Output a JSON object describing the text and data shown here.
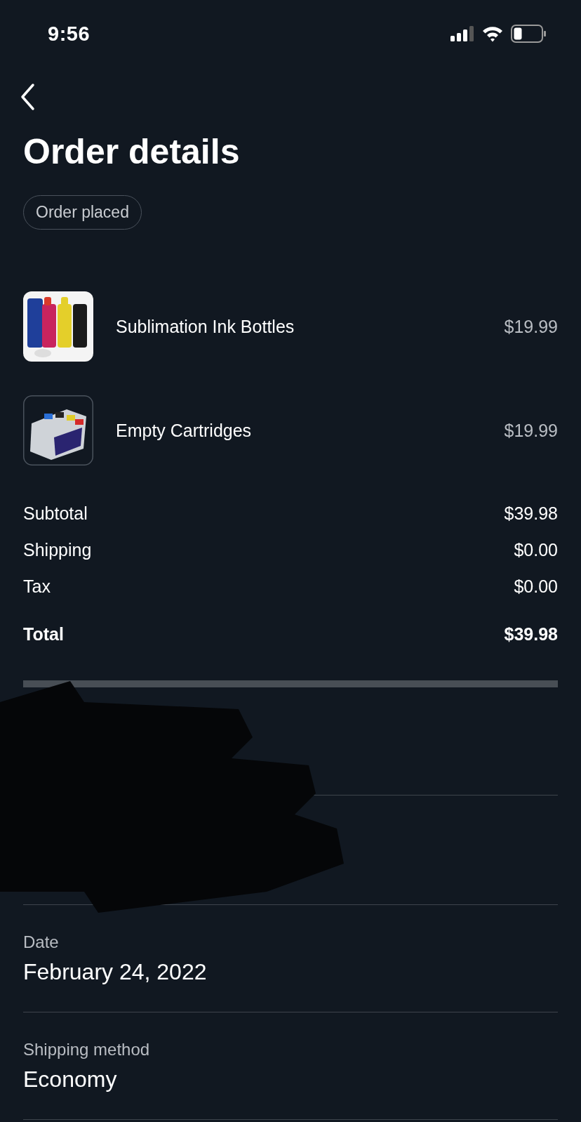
{
  "status_bar": {
    "time": "9:56"
  },
  "header": {
    "title": "Order details",
    "status_badge": "Order placed"
  },
  "items": [
    {
      "name": "Sublimation Ink Bottles",
      "price": "$19.99",
      "kind": "picture"
    },
    {
      "name": "Empty Cartridges",
      "price": "$19.99",
      "kind": "picture"
    }
  ],
  "summary": [
    {
      "label": "Subtotal",
      "value": "$39.98",
      "kind": "line"
    },
    {
      "label": "Shipping",
      "value": "$0.00",
      "kind": "line"
    },
    {
      "label": "Tax",
      "value": "$0.00",
      "kind": "line"
    },
    {
      "label": "Total",
      "value": "$39.98",
      "kind": "total"
    }
  ],
  "details": [
    {
      "kind": "redacted"
    },
    {
      "kind": "redacted"
    },
    {
      "kind": "field",
      "label": "Date",
      "value": "February 24, 2022"
    },
    {
      "kind": "field",
      "label": "Shipping method",
      "value": "Economy"
    }
  ]
}
